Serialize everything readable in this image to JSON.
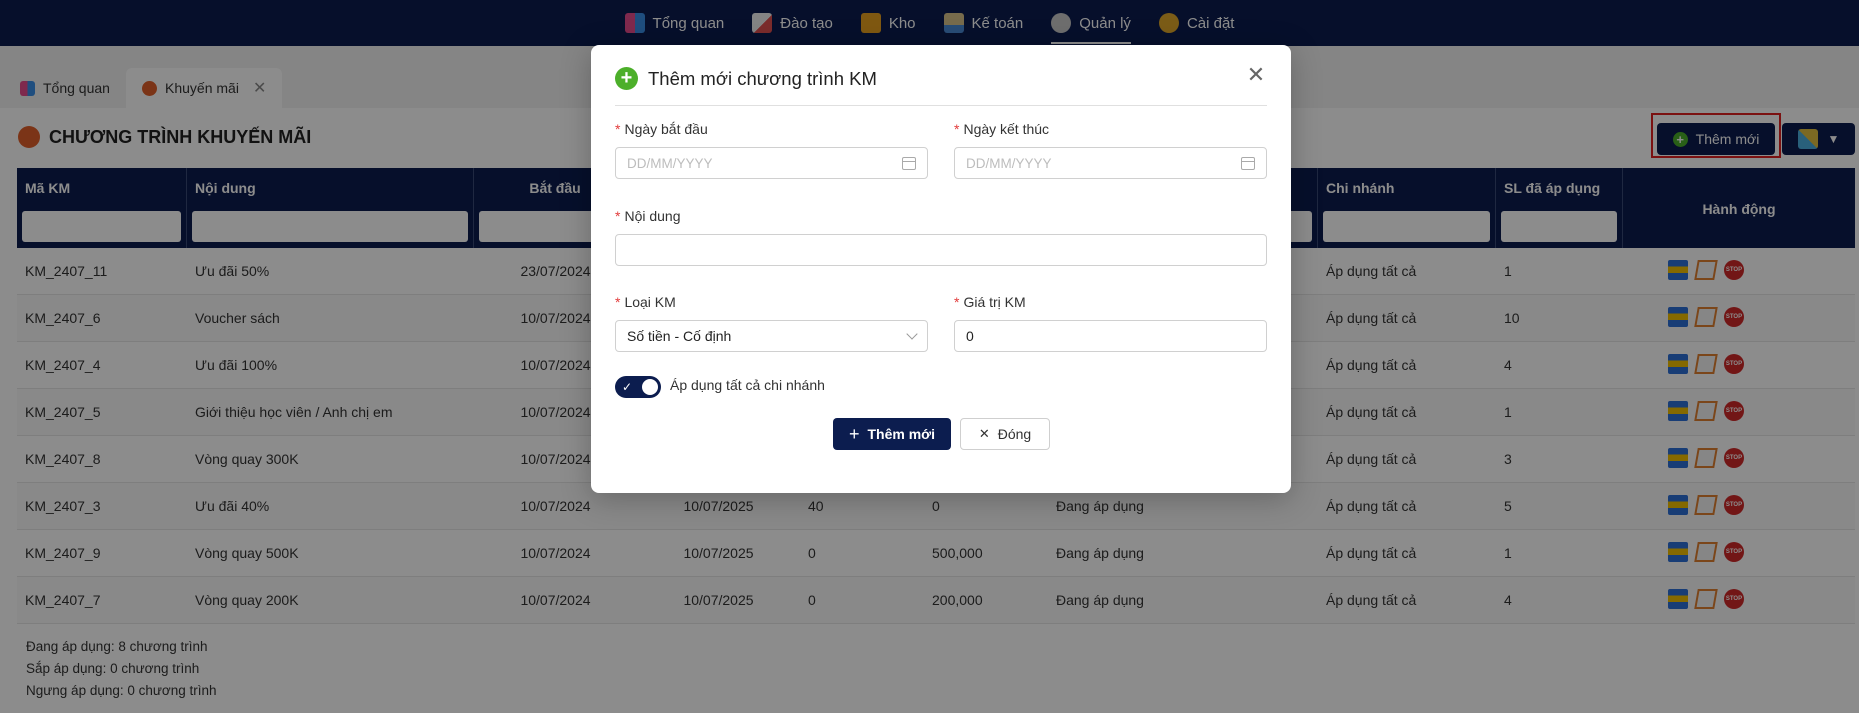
{
  "topnav": {
    "items": [
      {
        "label": "Tổng quan",
        "icon": "dashboard-icon"
      },
      {
        "label": "Đào tạo",
        "icon": "training-icon"
      },
      {
        "label": "Kho",
        "icon": "warehouse-icon"
      },
      {
        "label": "Kế toán",
        "icon": "accounting-icon"
      },
      {
        "label": "Quản lý",
        "icon": "management-icon"
      },
      {
        "label": "Cài đặt",
        "icon": "settings-icon"
      }
    ],
    "active": "Quản lý"
  },
  "tabs": [
    {
      "label": "Tổng quan"
    },
    {
      "label": "Khuyến mãi",
      "close": "✕"
    }
  ],
  "page": {
    "title": "CHƯƠNG TRÌNH KHUYẾN MÃI",
    "add_label": "Thêm mới",
    "tools_caret": "▼"
  },
  "table": {
    "headers": {
      "code": "Mã KM",
      "content": "Nội dung",
      "start": "Bắt đầu",
      "branch": "Chi nhánh",
      "applied": "SL đã áp dụng",
      "actions": "Hành động"
    },
    "rows": [
      {
        "code": "KM_2407_11",
        "content": "Ưu đãi 50%",
        "start": "23/07/2024",
        "end": "",
        "c1": "",
        "c2": "",
        "status": "",
        "branch": "Áp dụng tất cả",
        "applied": "1"
      },
      {
        "code": "KM_2407_6",
        "content": "Voucher sách",
        "start": "10/07/2024",
        "end": "",
        "c1": "",
        "c2": "",
        "status": "",
        "branch": "Áp dụng tất cả",
        "applied": "10"
      },
      {
        "code": "KM_2407_4",
        "content": "Ưu đãi 100%",
        "start": "10/07/2024",
        "end": "",
        "c1": "",
        "c2": "",
        "status": "",
        "branch": "Áp dụng tất cả",
        "applied": "4"
      },
      {
        "code": "KM_2407_5",
        "content": "Giới thiệu học viên / Anh chị em",
        "start": "10/07/2024",
        "end": "",
        "c1": "",
        "c2": "",
        "status": "",
        "branch": "Áp dụng tất cả",
        "applied": "1"
      },
      {
        "code": "KM_2407_8",
        "content": "Vòng quay 300K",
        "start": "10/07/2024",
        "end": "",
        "c1": "",
        "c2": "",
        "status": "",
        "branch": "Áp dụng tất cả",
        "applied": "3"
      },
      {
        "code": "KM_2407_3",
        "content": "Ưu đãi 40%",
        "start": "10/07/2024",
        "end": "10/07/2025",
        "c1": "40",
        "c2": "0",
        "status": "Đang áp dụng",
        "branch": "Áp dụng tất cả",
        "applied": "5"
      },
      {
        "code": "KM_2407_9",
        "content": "Vòng quay 500K",
        "start": "10/07/2024",
        "end": "10/07/2025",
        "c1": "0",
        "c2": "500,000",
        "status": "Đang áp dụng",
        "branch": "Áp dụng tất cả",
        "applied": "1"
      },
      {
        "code": "KM_2407_7",
        "content": "Vòng quay 200K",
        "start": "10/07/2024",
        "end": "10/07/2025",
        "c1": "0",
        "c2": "200,000",
        "status": "Đang áp dụng",
        "branch": "Áp dụng tất cả",
        "applied": "4"
      }
    ],
    "stop_label": "STOP"
  },
  "summary": [
    "Đang áp dụng: 8 chương trình",
    "Sắp áp dụng: 0 chương trình",
    "Ngưng áp dụng: 0 chương trình"
  ],
  "modal": {
    "title": "Thêm mới chương trình KM",
    "close": "✕",
    "start_label": "Ngày bắt đầu",
    "start_placeholder": "DD/MM/YYYY",
    "end_label": "Ngày kết thúc",
    "end_placeholder": "DD/MM/YYYY",
    "content_label": "Nội dung",
    "content_value": "",
    "type_label": "Loại KM",
    "type_value": "Số tiền - Cố định",
    "value_label": "Giá trị KM",
    "value_value": "0",
    "apply_all_label": "Áp dụng tất cả chi nhánh",
    "apply_all_on": true,
    "required_mark": "*",
    "submit_label": "Thêm mới",
    "cancel_label": "Đóng"
  },
  "colors": {
    "navy": "#0c1d4f",
    "green": "#4caf2a",
    "required": "#e23b3b",
    "highlight": "#e02020"
  }
}
